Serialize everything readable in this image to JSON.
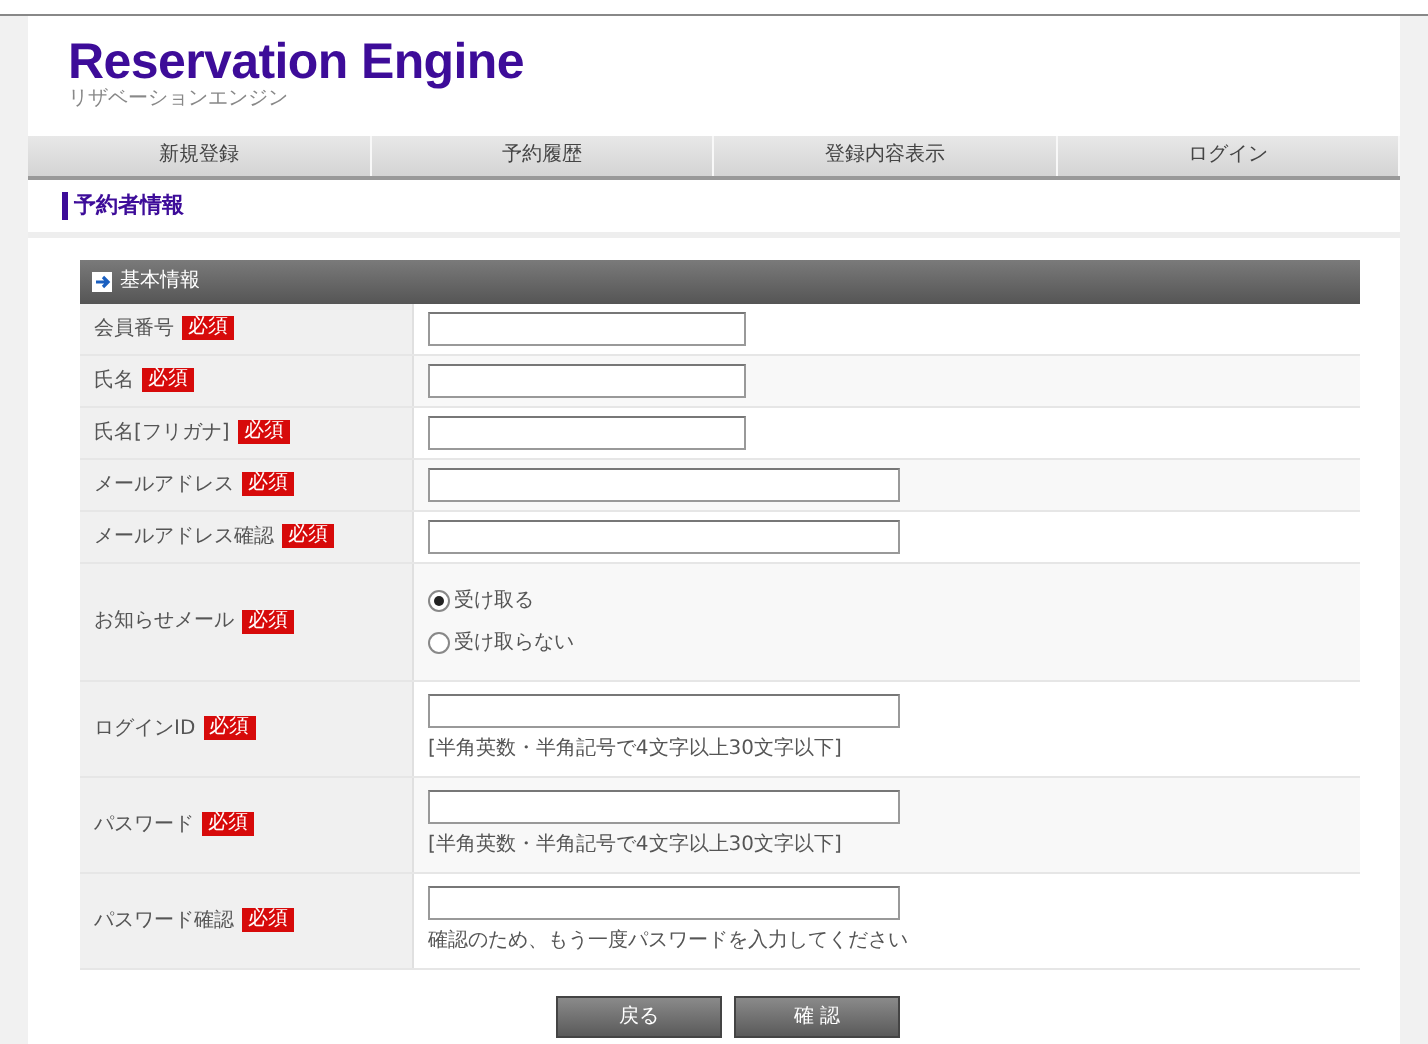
{
  "header": {
    "title": "Reservation Engine",
    "subtitle": "リザベーションエンジン"
  },
  "nav": [
    {
      "label": "新規登録"
    },
    {
      "label": "予約履歴"
    },
    {
      "label": "登録内容表示"
    },
    {
      "label": "ログイン"
    }
  ],
  "section_title": "予約者情報",
  "form": {
    "title": "基本情報",
    "rows": [
      {
        "label": "会員番号",
        "badge": "必須",
        "kind": "short_text"
      },
      {
        "label": "氏名",
        "badge": "必須",
        "kind": "short_text"
      },
      {
        "label": "氏名[フリガナ]",
        "badge": "必須",
        "kind": "short_text"
      },
      {
        "label": "メールアドレス",
        "badge": "必須",
        "kind": "long_text"
      },
      {
        "label": "メールアドレス確認",
        "badge": "必須",
        "kind": "long_text"
      },
      {
        "label": "お知らせメール",
        "badge": "必須",
        "kind": "radio",
        "options": [
          {
            "label": "受け取る",
            "selected": true
          },
          {
            "label": "受け取らない",
            "selected": false
          }
        ]
      },
      {
        "label": "ログインID",
        "badge": "必須",
        "kind": "long_text",
        "note": "[半角英数・半角記号で4文字以上30文字以下]"
      },
      {
        "label": "パスワード",
        "badge": "必須",
        "kind": "long_text",
        "note": "[半角英数・半角記号で4文字以上30文字以下]"
      },
      {
        "label": "パスワード確認",
        "badge": "必須",
        "kind": "long_text",
        "note": "確認のため、もう一度パスワードを入力してください"
      }
    ]
  },
  "buttons": [
    {
      "label": "戻る"
    },
    {
      "label": "確 認"
    }
  ]
}
